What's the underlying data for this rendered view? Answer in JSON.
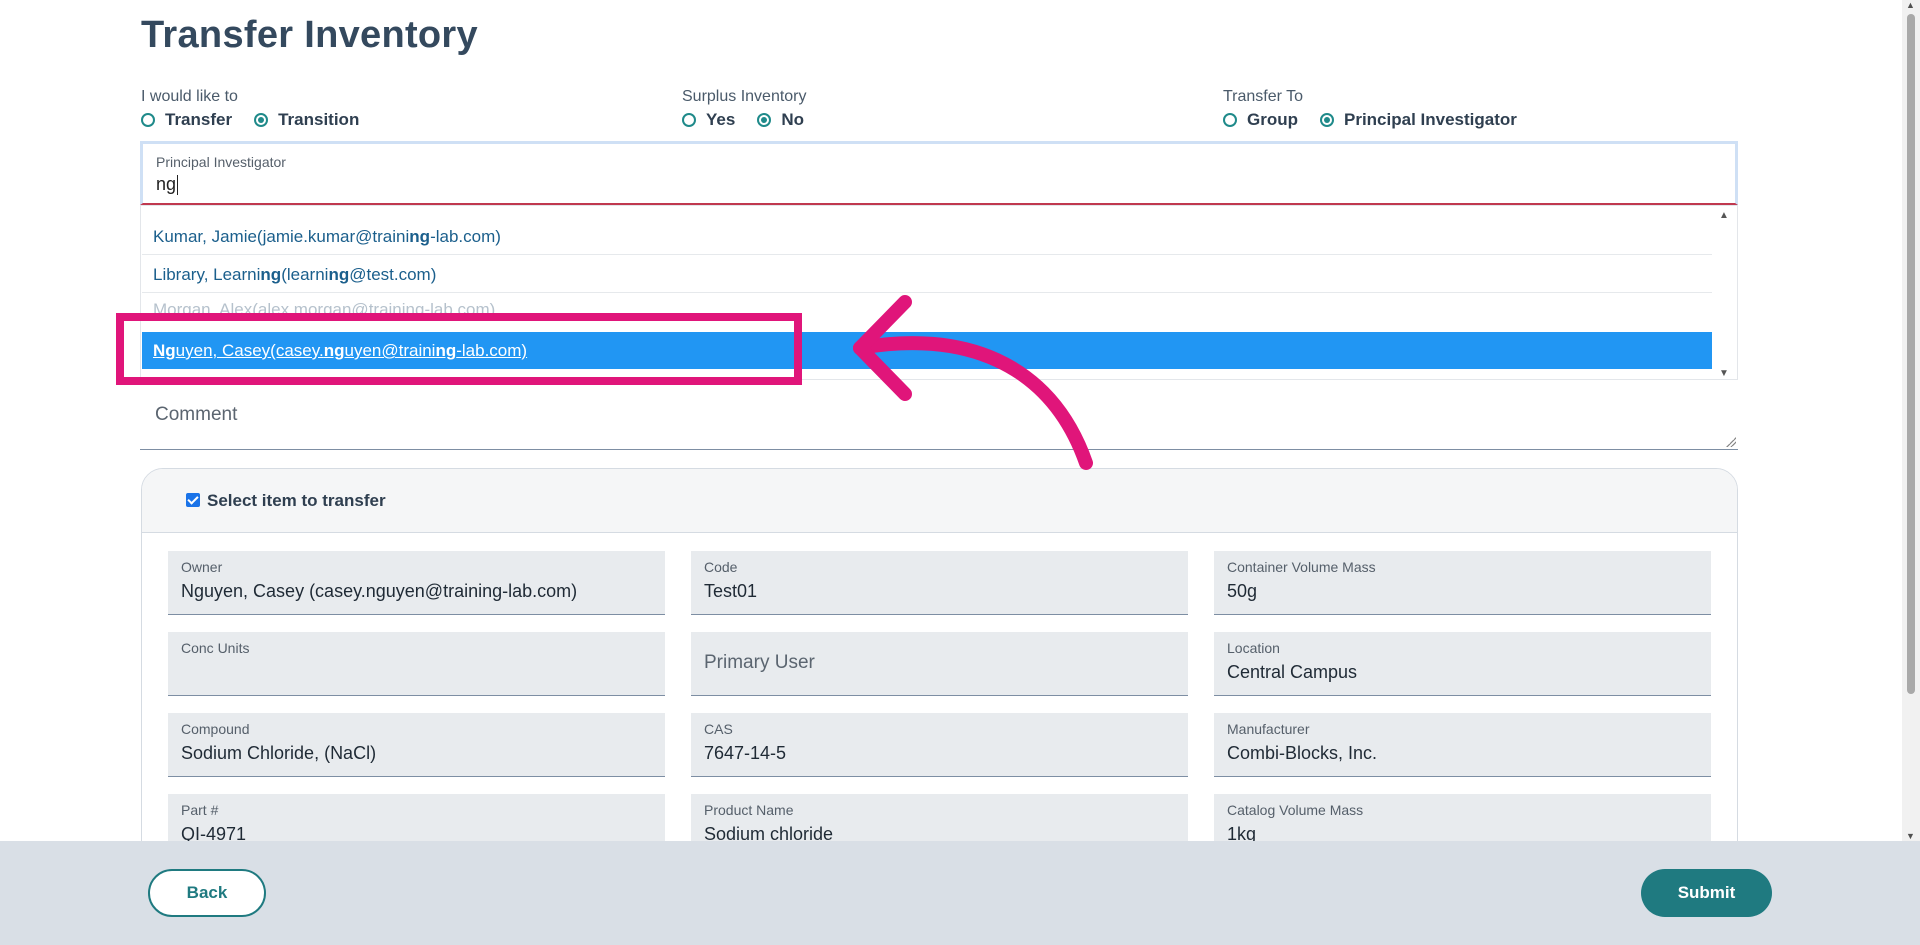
{
  "page": {
    "title": "Transfer Inventory"
  },
  "intent": {
    "label": "I would like to",
    "options": [
      "Transfer",
      "Transition"
    ],
    "selected": "Transition"
  },
  "surplus": {
    "label": "Surplus Inventory",
    "options": [
      "Yes",
      "No"
    ],
    "selected": "No"
  },
  "transfer_to": {
    "label": "Transfer To",
    "options": [
      "Group",
      "Principal Investigator"
    ],
    "selected": "Principal Investigator"
  },
  "pi_field": {
    "label": "Principal Investigator",
    "value": "ng"
  },
  "suggestions": [
    {
      "parts": [
        "Kumar, Jamie(jamie.kumar@traini",
        "ng",
        "-lab.com)"
      ]
    },
    {
      "parts": [
        "Library, Learni",
        "ng",
        "(learni",
        "ng",
        "@test.com)"
      ]
    },
    {
      "parts": [
        "Morgan, Alex(alex.morgan@training-lab.com)"
      ]
    },
    {
      "parts": [
        "Ng",
        "uyen, Casey(casey.",
        "ng",
        "uyen@traini",
        "ng",
        "-lab.com)"
      ]
    }
  ],
  "comment": {
    "placeholder": "Comment"
  },
  "item_card": {
    "checkbox_label": "Select item to transfer",
    "checked": true,
    "fields": [
      {
        "label": "Owner",
        "value": "Nguyen, Casey (casey.nguyen@training-lab.com)"
      },
      {
        "label": "Code",
        "value": "Test01"
      },
      {
        "label": "Container Volume Mass",
        "value": "50g"
      },
      {
        "label": "Conc Units",
        "value": ""
      },
      {
        "label": "",
        "value": "",
        "placeholder": "Primary User"
      },
      {
        "label": "Location",
        "value": "Central Campus"
      },
      {
        "label": "Compound",
        "value": "Sodium Chloride, (NaCl)"
      },
      {
        "label": "CAS",
        "value": "7647-14-5"
      },
      {
        "label": "Manufacturer",
        "value": "Combi-Blocks, Inc."
      },
      {
        "label": "Part #",
        "value": "QI-4971"
      },
      {
        "label": "Product Name",
        "value": "Sodium chloride"
      },
      {
        "label": "Catalog Volume Mass",
        "value": "1kg"
      }
    ]
  },
  "footer": {
    "back_label": "Back",
    "submit_label": "Submit"
  },
  "colors": {
    "accent": "#1f7a80",
    "selection": "#2196f3",
    "annotation": "#e0157a"
  },
  "icons": {
    "dropdown_up": "triangle-up-icon",
    "dropdown_down": "triangle-down-icon",
    "annotation": "curved-arrow-icon"
  }
}
